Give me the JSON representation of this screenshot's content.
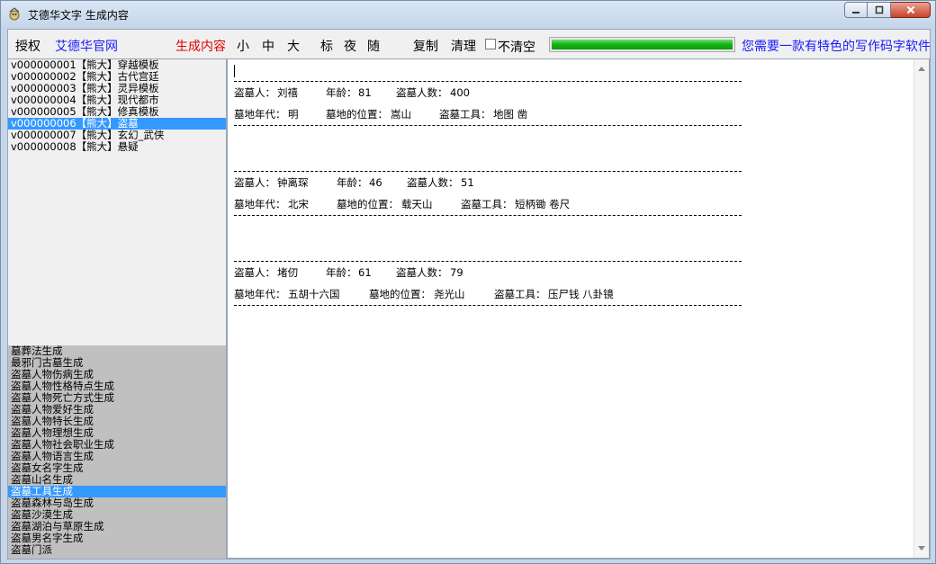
{
  "window": {
    "title": "艾德华文字 生成内容"
  },
  "toolbar": {
    "authorize": "授权",
    "official_site": "艾德华官网",
    "generate": "生成内容",
    "size_small": "小",
    "size_medium": "中",
    "size_large": "大",
    "mode_standard": "标",
    "mode_night": "夜",
    "mode_random": "随",
    "copy": "复制",
    "clear": "清理",
    "no_clear": "不清空",
    "progress": 1.0,
    "ad_text": "您需要一款有特色的写作码字软件"
  },
  "templates": [
    "v000000001【熊大】穿越模板",
    "v000000002【熊大】古代宫廷",
    "v000000003【熊大】灵异模板",
    "v000000004【熊大】现代都市",
    "v000000005【熊大】修真模板",
    "v000000006【熊大】盗墓",
    "v000000007【熊大】玄幻_武侠",
    "v000000008【熊大】悬疑"
  ],
  "templates_selected": 5,
  "generators": [
    "墓葬法生成",
    "最邪门古墓生成",
    "盗墓人物伤病生成",
    "盗墓人物性格特点生成",
    "盗墓人物死亡方式生成",
    "盗墓人物爱好生成",
    "盗墓人物特长生成",
    "盗墓人物理想生成",
    "盗墓人物社会职业生成",
    "盗墓人物语言生成",
    "盗墓女名字生成",
    "盗墓山名生成",
    "盗墓工具生成",
    "盗墓森林与岛生成",
    "盗墓沙漠生成",
    "盗墓湖泊与草原生成",
    "盗墓男名字生成",
    "盗墓门派"
  ],
  "generators_selected": 12,
  "records": [
    {
      "robber_label": "盗墓人：",
      "robber": "刘禧",
      "age_label": "年龄：",
      "age": "81",
      "count_label": "盗墓人数：",
      "count": "400",
      "era_label": "墓地年代：",
      "era": "明",
      "location_label": "墓地的位置：",
      "location": "嵩山",
      "tools_label": "盗墓工具：",
      "tools": "地图  凿"
    },
    {
      "robber_label": "盗墓人：",
      "robber": "钟离琛",
      "age_label": "年龄：",
      "age": "46",
      "count_label": "盗墓人数：",
      "count": "51",
      "era_label": "墓地年代：",
      "era": "北宋",
      "location_label": "墓地的位置：",
      "location": "载天山",
      "tools_label": "盗墓工具：",
      "tools": "短柄锄  卷尺"
    },
    {
      "robber_label": "盗墓人：",
      "robber": "堵仞",
      "age_label": "年龄：",
      "age": "61",
      "count_label": "盗墓人数：",
      "count": "79",
      "era_label": "墓地年代：",
      "era": "五胡十六国",
      "location_label": "墓地的位置：",
      "location": "尧光山",
      "tools_label": "盗墓工具：",
      "tools": "压尸钱  八卦镜"
    }
  ]
}
